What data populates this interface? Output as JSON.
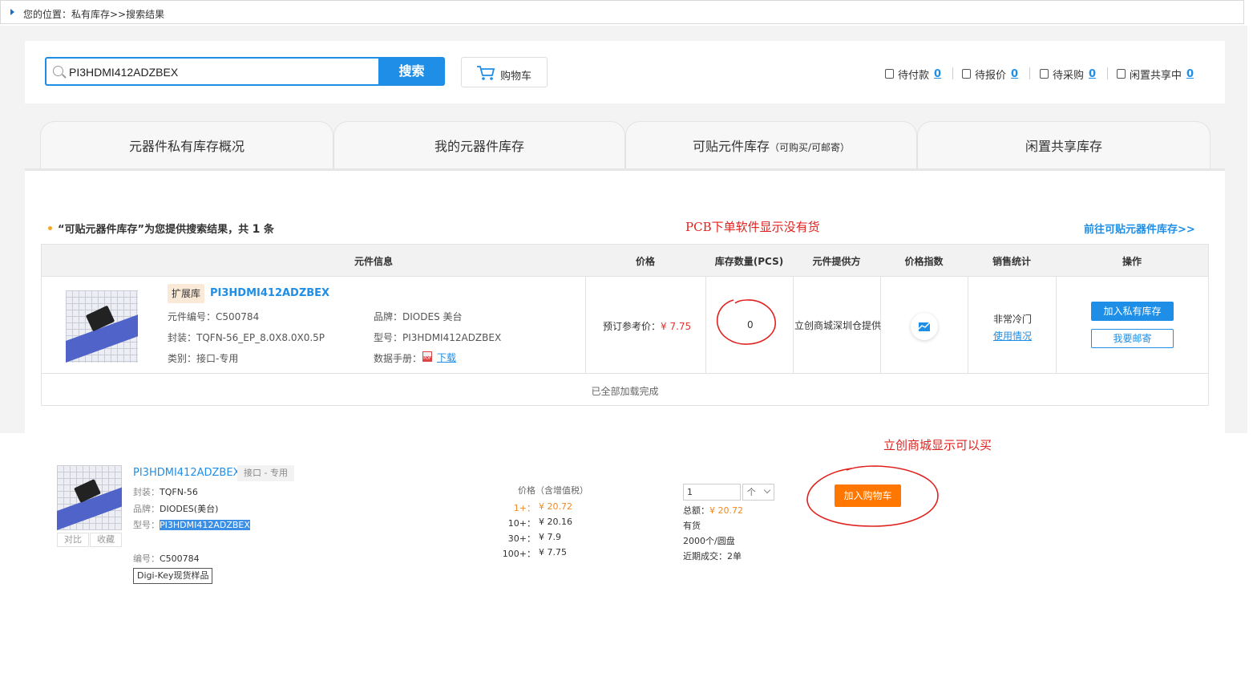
{
  "breadcrumb": {
    "text": "您的位置：私有库存>>搜索结果"
  },
  "search": {
    "value": "PI3HDMI412ADZBEX",
    "button_label": "搜索",
    "cart_label": "购物车"
  },
  "status_bar": [
    {
      "label": "待付款",
      "count": "0",
      "icon": "wallet-icon"
    },
    {
      "label": "待报价",
      "count": "0",
      "icon": "quote-icon"
    },
    {
      "label": "待采购",
      "count": "0",
      "icon": "purchase-icon"
    },
    {
      "label": "闲置共享中",
      "count": "0",
      "icon": "share-icon"
    }
  ],
  "tabs": [
    {
      "label": "元器件私有库存概况",
      "sub": ""
    },
    {
      "label": "我的元器件库存",
      "sub": ""
    },
    {
      "label": "可贴元件库存",
      "sub": "（可购买/可邮寄）"
    },
    {
      "label": "闲置共享库存",
      "sub": ""
    }
  ],
  "results": {
    "summary_prefix": "“可贴元器件库存”为您提供搜索结果，共",
    "count": "1",
    "summary_suffix": "条",
    "annotation": "PCB下单软件显示没有货",
    "goto_link": "前往可贴元器件库存>>"
  },
  "table": {
    "headers": [
      "元件信息",
      "价格",
      "库存数量(PCS)",
      "元件提供方",
      "价格指数",
      "销售统计",
      "操作"
    ],
    "row": {
      "tag": "扩展库",
      "part_number": "PI3HDMI412ADZBEX",
      "code_label": "元件编号：",
      "code": "C500784",
      "brand_label": "品牌：",
      "brand": "DIODES 美台",
      "package_label": "封装：",
      "package": "TQFN-56_EP_8.0X8.0X0.5P",
      "model_label": "型号：",
      "model": "PI3HDMI412ADZBEX",
      "category_label": "类别：",
      "category": "接口-专用",
      "datasheet_label": "数据手册：",
      "datasheet_link": "下载",
      "price_label": "预订参考价：",
      "price": "¥ 7.75",
      "stock": "0",
      "supplier": "立创商城深圳仓提供",
      "sales": "非常冷门",
      "usage_link": "使用情况",
      "btn_add_private": "加入私有库存",
      "btn_mail": "我要邮寄"
    },
    "footer": "已全部加载完成"
  },
  "mall": {
    "annotation": "立创商城显示可以买",
    "compare_label": "对比",
    "fav_label": "收藏",
    "title": "PI3HDMI412ADZBEX",
    "category": "接口 - 专用",
    "package_label": "封装：",
    "package": "TQFN-56",
    "brand_label": "品牌：",
    "brand": "DIODES(美台)",
    "model_label": "型号：",
    "model": "PI3HDMI412ADZBEX",
    "code_label": "编号：",
    "code": "C500784",
    "tag": "Digi-Key现货样品",
    "price_head": "价格（含增值税）",
    "tiers": [
      {
        "qty": "1+：",
        "price": "¥ 20.72"
      },
      {
        "qty": "10+：",
        "price": "¥ 20.16"
      },
      {
        "qty": "30+：",
        "price": "¥ 7.9"
      },
      {
        "qty": "100+：",
        "price": "¥ 7.75"
      }
    ],
    "qty_value": "1",
    "stepper_label": "个",
    "total_label": "总额：",
    "total": "¥ 20.72",
    "in_stock": "有货",
    "reel": "2000个/圆盘",
    "recent": "近期成交：2单",
    "add_cart": "加入购物车"
  }
}
